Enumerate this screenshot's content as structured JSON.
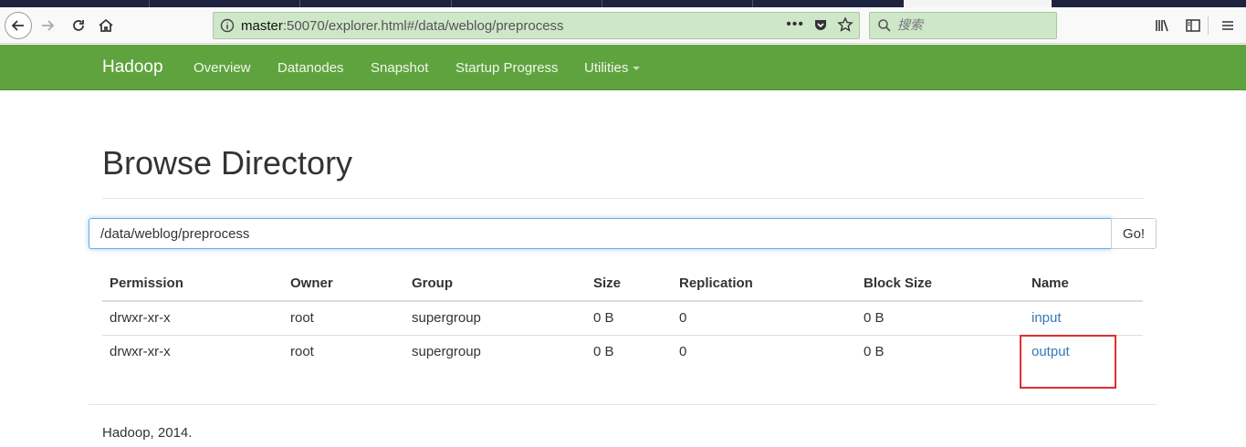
{
  "browser": {
    "url_host": "master",
    "url_rest": ":50070/explorer.html#/data/weblog/preprocess",
    "search_placeholder": "搜索"
  },
  "nav": {
    "brand": "Hadoop",
    "items": [
      "Overview",
      "Datanodes",
      "Snapshot",
      "Startup Progress",
      "Utilities"
    ]
  },
  "page": {
    "title": "Browse Directory",
    "path_value": "/data/weblog/preprocess",
    "go_label": "Go!"
  },
  "table": {
    "headers": [
      "Permission",
      "Owner",
      "Group",
      "Size",
      "Replication",
      "Block Size",
      "Name"
    ],
    "rows": [
      [
        "drwxr-xr-x",
        "root",
        "supergroup",
        "0 B",
        "0",
        "0 B",
        "input"
      ],
      [
        "drwxr-xr-x",
        "root",
        "supergroup",
        "0 B",
        "0",
        "0 B",
        "output"
      ]
    ]
  },
  "footer": "Hadoop, 2014.",
  "colors": {
    "navbar": "#5fa33e",
    "link": "#337ab7",
    "highlight": "#e03030",
    "urlbar": "#cfe7c9"
  }
}
